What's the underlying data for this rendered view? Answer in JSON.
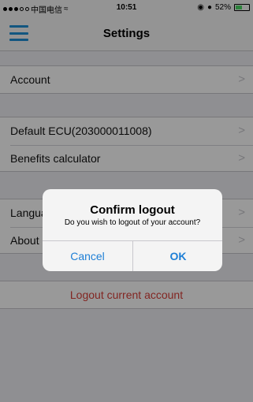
{
  "status_bar": {
    "carrier": "中国电信",
    "time": "10:51",
    "battery": "52%",
    "battery_level": 0.52
  },
  "nav": {
    "title": "Settings"
  },
  "settings": {
    "account": "Account",
    "default_ecu": "Default ECU(203000011008)",
    "benefits": "Benefits calculator",
    "language": "Language",
    "about": "About",
    "logout": "Logout current account",
    "chevron": ">"
  },
  "dialog": {
    "title": "Confirm logout",
    "message": "Do you wish to logout of your account?",
    "cancel": "Cancel",
    "ok": "OK"
  },
  "colors": {
    "accent": "#1e7fd6",
    "danger": "#d9403a"
  }
}
